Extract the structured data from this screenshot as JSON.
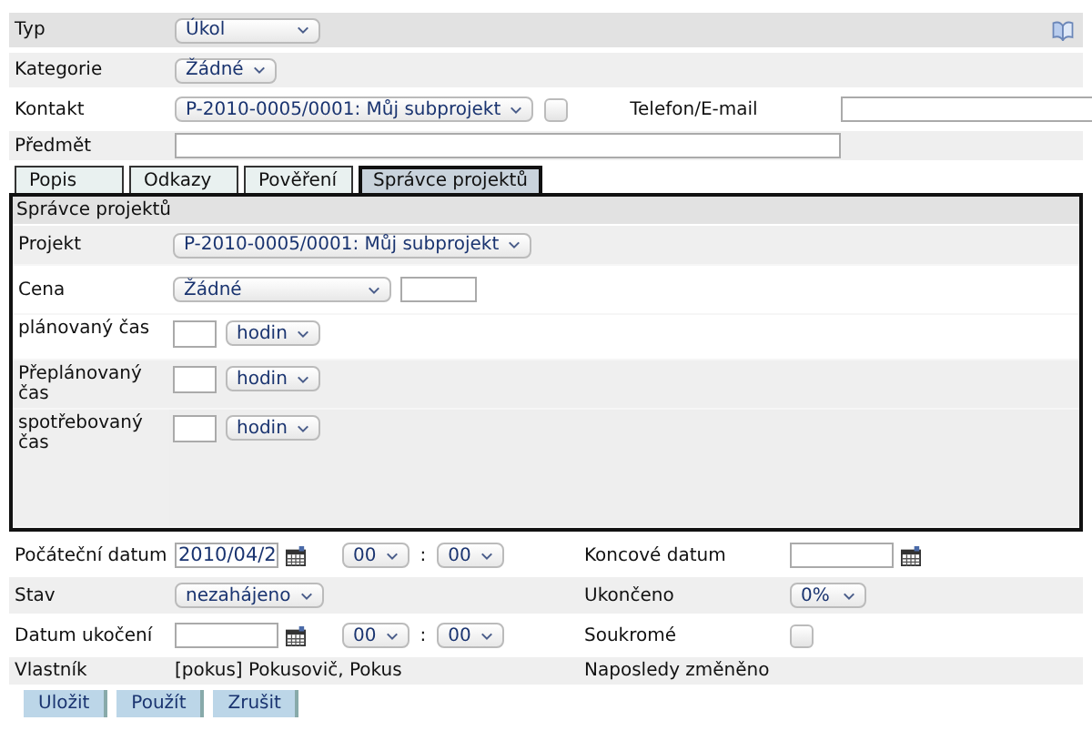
{
  "top": {
    "type": {
      "label": "Typ",
      "value": "Úkol"
    },
    "category": {
      "label": "Kategorie",
      "value": "Žádné"
    },
    "contact": {
      "label": "Kontakt",
      "value": "P-2010-0005/0001: Můj subprojekt",
      "checked": false,
      "phone_label": "Telefon/E-mail"
    },
    "subject": {
      "label": "Předmět"
    }
  },
  "tabs": [
    {
      "label": "Popis",
      "selected": false
    },
    {
      "label": "Odkazy",
      "selected": false
    },
    {
      "label": "Pověření",
      "selected": false
    },
    {
      "label": "Správce projektů",
      "selected": true
    }
  ],
  "panel": {
    "title": "Správce projektů",
    "rows": [
      {
        "kind": "select",
        "label": "Projekt",
        "value": "P-2010-0005/0001: Můj subprojekt"
      },
      {
        "kind": "price",
        "label": "Cena",
        "value": "Žádné"
      },
      {
        "kind": "time",
        "label": "plánovaný čas",
        "unit": "hodin"
      },
      {
        "kind": "time",
        "label": "Přeplánovaný čas",
        "unit": "hodin"
      },
      {
        "kind": "time",
        "label": "spotřebovaný čas",
        "unit": "hodin"
      }
    ]
  },
  "bottom": [
    {
      "left": {
        "kind": "datetime",
        "label": "Počáteční datum",
        "value": "2010/04/2",
        "hour": "00",
        "minute": "00",
        "sep": ":"
      },
      "right": {
        "kind": "date",
        "label": "Koncové datum"
      }
    },
    {
      "left": {
        "kind": "select",
        "label": "Stav",
        "value": "nezahájeno"
      },
      "right": {
        "kind": "select",
        "label": "Ukončeno",
        "value": "0%"
      }
    },
    {
      "left": {
        "kind": "datetime",
        "label": "Datum ukočení",
        "hour": "00",
        "minute": "00",
        "sep": ":"
      },
      "right": {
        "kind": "checkbox",
        "label": "Soukromé",
        "checked": false
      }
    },
    {
      "left": {
        "kind": "text",
        "label": "Vlastník",
        "value": "[pokus] Pokusovič, Pokus"
      },
      "right": {
        "kind": "text",
        "label": "Naposledy změněno"
      }
    }
  ],
  "buttons": [
    "Uložit",
    "Použít",
    "Zrušit"
  ]
}
